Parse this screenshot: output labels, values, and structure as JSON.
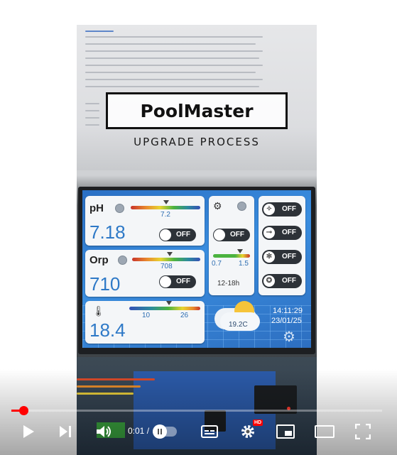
{
  "overlay": {
    "brand": "PoolMaster",
    "subtitle": "UPGRADE PROCESS"
  },
  "lcd": {
    "ph": {
      "label": "pH",
      "value": "7.18",
      "marker": "7.2",
      "toggle": "OFF"
    },
    "orp": {
      "label": "Orp",
      "value": "710",
      "marker": "708",
      "toggle": "OFF"
    },
    "temp": {
      "value": "18.4",
      "scale_low": "10",
      "scale_high": "26"
    },
    "pump": {
      "toggle": "OFF",
      "scale_low": "0.7",
      "scale_high": "1.5",
      "schedule": "12-18h"
    },
    "weather": {
      "temperature": "19.2C",
      "time": "14:11:29",
      "date": "23/01/25"
    },
    "devices": [
      {
        "icon": "lightbulb-icon",
        "state": "OFF"
      },
      {
        "icon": "filter-icon",
        "state": "OFF"
      },
      {
        "icon": "snowflake-icon",
        "state": "OFF"
      },
      {
        "icon": "robot-cleaner-icon",
        "state": "OFF"
      }
    ]
  },
  "player": {
    "time": "0:01 /",
    "progress": 0.033,
    "quality_badge": "HD",
    "colors": {
      "progress": "#ff0000",
      "controls": "#ffffff"
    }
  }
}
